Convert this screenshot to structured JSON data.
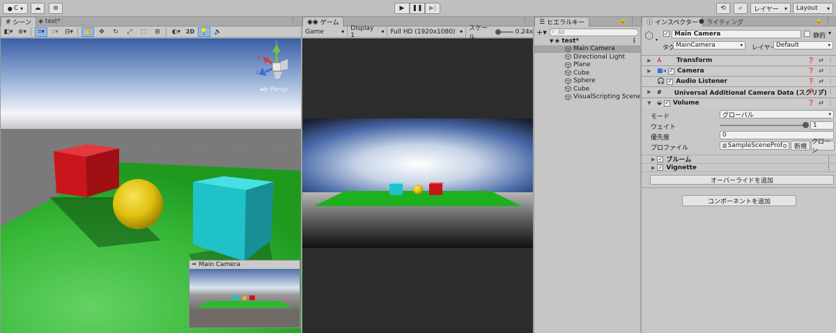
{
  "toolbar": {
    "account_label": "C",
    "layers_label": "レイヤー",
    "layout_label": "Layout"
  },
  "scene": {
    "tab_label": "シーン",
    "file_tab_label": "test*",
    "view_2d_label": "2D",
    "persp_label": "Persp",
    "gizmo_axes": {
      "x": "x",
      "y": "y",
      "z": "z"
    },
    "mini_camera_title": "Main Camera"
  },
  "game": {
    "tab_label": "ゲーム",
    "display_mode": "Game",
    "display": "Display 1",
    "resolution": "Full HD (1920x1080)",
    "scale_label": "スケール",
    "scale_value": "0.24x"
  },
  "hierarchy": {
    "tab_label": "ヒエラルキー",
    "search_placeholder": "All",
    "scene_name": "test*",
    "items": [
      {
        "label": "Main Camera",
        "selected": true
      },
      {
        "label": "Directional Light"
      },
      {
        "label": "Plane"
      },
      {
        "label": "Cube"
      },
      {
        "label": "Sphere"
      },
      {
        "label": "Cube"
      },
      {
        "label": "VisualScripting SceneVa"
      }
    ]
  },
  "inspector": {
    "tab_label": "インスペクター",
    "lighting_tab_label": "ライティング",
    "object_name": "Main Camera",
    "static_label": "静的",
    "tag_label": "タグ",
    "tag_value": "MainCamera",
    "layer_label": "レイヤー",
    "layer_value": "Default",
    "components": {
      "transform": "Transform",
      "camera": "Camera",
      "audio_listener": "Audio Listener",
      "urp_data": "Universal Additional Camera Data (スクリプ)",
      "volume": "Volume"
    },
    "volume": {
      "mode_label": "モード",
      "mode_value": "グローバル",
      "weight_label": "ウェイト",
      "weight_value": "1",
      "weight_fraction": 1.0,
      "priority_label": "優先度",
      "priority_value": "0",
      "profile_label": "プロファイル",
      "profile_value": "SampleSceneProfil",
      "new_label": "新規",
      "clone_label": "クローン",
      "overrides": [
        "ブルーム",
        "Vignette"
      ],
      "add_override_label": "オーバーライドを追加"
    },
    "add_component_label": "コンポーネントを追加"
  },
  "colors": {
    "selection": "#8fb8e6",
    "cube_red": "#c8161c",
    "cube_cyan": "#1fc2c8",
    "sphere_yellow": "#e0c10e",
    "ground_green": "#2fb82f"
  }
}
